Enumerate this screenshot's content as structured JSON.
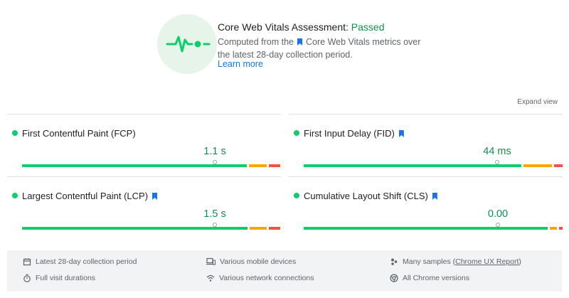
{
  "assessment": {
    "title": "Core Web Vitals Assessment: ",
    "status": "Passed",
    "desc_pre": "Computed from the",
    "desc_post": "Core Web Vitals metrics over the latest 28-day collection period.",
    "learn_more": "Learn more"
  },
  "expand_view": "Expand view",
  "metrics": {
    "fcp": {
      "name": "First Contentful Paint (FCP)",
      "value": "1.1 s"
    },
    "fid": {
      "name": "First Input Delay (FID)",
      "value": "44 ms"
    },
    "lcp": {
      "name": "Largest Contentful Paint (LCP)",
      "value": "1.5 s"
    },
    "cls": {
      "name": "Cumulative Layout Shift (CLS)",
      "value": "0.00"
    }
  },
  "footer": {
    "collection_period": "Latest 28-day collection period",
    "devices": "Various mobile devices",
    "samples_pre": "Many samples (",
    "samples_link": "Chrome UX Report",
    "samples_post": ")",
    "durations": "Full visit durations",
    "network": "Various network connections",
    "chrome_versions": "All Chrome versions"
  },
  "colors": {
    "good": "#0cce6b",
    "average": "#ffa400",
    "poor": "#ff4e42",
    "passed_text": "#0d904f",
    "link": "#1a73e8"
  }
}
